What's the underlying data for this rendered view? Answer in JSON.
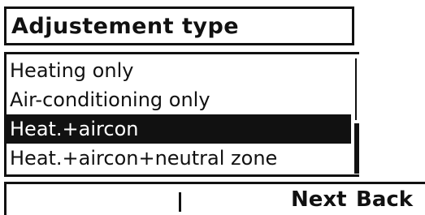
{
  "screen": {
    "title": "Adjustement type"
  },
  "options": {
    "items": [
      {
        "label": "Heating only"
      },
      {
        "label": "Air-conditioning only"
      },
      {
        "label": "Heat.+aircon"
      },
      {
        "label": "Heat.+aircon+neutral zone"
      }
    ],
    "selected_label": "Heat.+aircon"
  },
  "softkeys": {
    "next_label": "Next",
    "back_label": "Back"
  },
  "colors": {
    "foreground": "#111111",
    "background": "#ffffff",
    "selection_background": "#111111",
    "selection_text": "#ffffff"
  }
}
